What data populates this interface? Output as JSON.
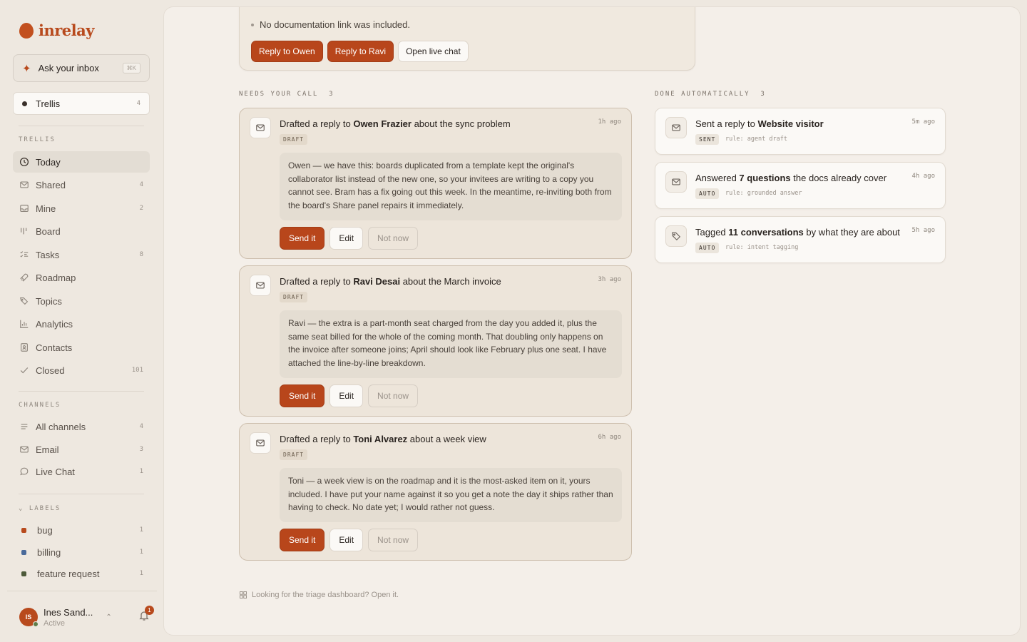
{
  "app": {
    "name": "inrelay"
  },
  "ask": {
    "label": "Ask your inbox",
    "shortcut": "⌘K"
  },
  "workspace": {
    "name": "Trellis",
    "count": "4"
  },
  "sections": {
    "workspace": "TRELLIS",
    "channels": "CHANNELS",
    "labels": "LABELS"
  },
  "nav": [
    {
      "label": "Today",
      "count": ""
    },
    {
      "label": "Shared",
      "count": "4"
    },
    {
      "label": "Mine",
      "count": "2"
    },
    {
      "label": "Board",
      "count": ""
    },
    {
      "label": "Tasks",
      "count": "8"
    },
    {
      "label": "Roadmap",
      "count": ""
    },
    {
      "label": "Topics",
      "count": ""
    },
    {
      "label": "Analytics",
      "count": ""
    },
    {
      "label": "Contacts",
      "count": ""
    },
    {
      "label": "Closed",
      "count": "101"
    }
  ],
  "channels": [
    {
      "label": "All channels",
      "count": "4"
    },
    {
      "label": "Email",
      "count": "3"
    },
    {
      "label": "Live Chat",
      "count": "1"
    }
  ],
  "labels": [
    {
      "label": "bug",
      "count": "1",
      "color": "#b84a1d"
    },
    {
      "label": "billing",
      "count": "1",
      "color": "#4a6a9a"
    },
    {
      "label": "feature request",
      "count": "1",
      "color": "#4d5a3a"
    }
  ],
  "user": {
    "initials": "IS",
    "name": "Ines Sand...",
    "status": "Active",
    "notifications": "1"
  },
  "topcard": {
    "bullet": "No documentation link was included.",
    "buttons": [
      "Reply to Owen",
      "Reply to Ravi",
      "Open live chat"
    ]
  },
  "needs": {
    "heading": "NEEDS YOUR CALL",
    "count": "3"
  },
  "done": {
    "heading": "DONE AUTOMATICALLY",
    "count": "3"
  },
  "drafts": [
    {
      "prefix": "Drafted a reply to ",
      "name": "Owen Frazier",
      "suffix": " about the sync problem",
      "time": "1h ago",
      "tag": "DRAFT",
      "body": "Owen — we have this: boards duplicated from a template kept the original's collaborator list instead of the new one, so your invitees are writing to a copy you cannot see. Bram has a fix going out this week. In the meantime, re-inviting both from the board's Share panel repairs it immediately.",
      "send": "Send it",
      "edit": "Edit",
      "later": "Not now"
    },
    {
      "prefix": "Drafted a reply to ",
      "name": "Ravi Desai",
      "suffix": " about the March invoice",
      "time": "3h ago",
      "tag": "DRAFT",
      "body": "Ravi — the extra is a part-month seat charged from the day you added it, plus the same seat billed for the whole of the coming month. That doubling only happens on the invoice after someone joins; April should look like February plus one seat. I have attached the line-by-line breakdown.",
      "send": "Send it",
      "edit": "Edit",
      "later": "Not now"
    },
    {
      "prefix": "Drafted a reply to ",
      "name": "Toni Alvarez",
      "suffix": " about a week view",
      "time": "6h ago",
      "tag": "DRAFT",
      "body": "Toni — a week view is on the roadmap and it is the most-asked item on it, yours included. I have put your name against it so you get a note the day it ships rather than having to check. No date yet; I would rather not guess.",
      "send": "Send it",
      "edit": "Edit",
      "later": "Not now"
    }
  ],
  "auto": [
    {
      "prefix": "Sent a reply to ",
      "bold": "Website visitor",
      "suffix": "",
      "time": "5m ago",
      "tag": "SENT",
      "rule": "rule: agent draft",
      "icon": "mail-icon"
    },
    {
      "prefix": "Answered ",
      "bold": "7 questions",
      "suffix": " the docs already cover",
      "time": "4h ago",
      "tag": "AUTO",
      "rule": "rule: grounded answer",
      "icon": "mail-icon"
    },
    {
      "prefix": "Tagged ",
      "bold": "11 conversations",
      "suffix": " by what they are about",
      "time": "5h ago",
      "tag": "AUTO",
      "rule": "rule: intent tagging",
      "icon": "tag-icon"
    }
  ],
  "footer": {
    "text": "Looking for the triage dashboard? Open it."
  },
  "colors": {
    "accent": "#b8461b",
    "background": "#eee8e0",
    "panel": "#f4efe9"
  }
}
